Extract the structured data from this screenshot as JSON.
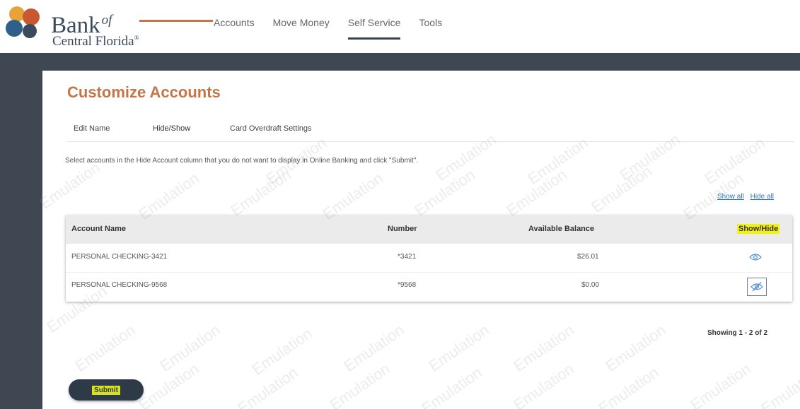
{
  "brand": {
    "name_line1": "Bank",
    "name_of": "of",
    "name_line2": "Central Florida",
    "trademark": "®"
  },
  "nav": {
    "items": [
      {
        "label": "Accounts"
      },
      {
        "label": "Move Money"
      },
      {
        "label": "Self Service",
        "active": true
      },
      {
        "label": "Tools"
      }
    ]
  },
  "page": {
    "title": "Customize Accounts",
    "tabs": [
      {
        "label": "Edit Name"
      },
      {
        "label": "Hide/Show",
        "active": true
      },
      {
        "label": "Card Overdraft Settings"
      }
    ],
    "instruction": "Select accounts in the Hide Account column that you do not want to display in Online Banking and click \"Submit\".",
    "show_all": "Show all",
    "hide_all": "Hide all"
  },
  "table": {
    "columns": [
      "Account Name",
      "Number",
      "Available Balance",
      "Show/Hide"
    ],
    "rows": [
      {
        "name": "PERSONAL CHECKING-3421",
        "number": "*3421",
        "balance": "$26.01",
        "visibility_icon": "eye-icon"
      },
      {
        "name": "PERSONAL CHECKING-9568",
        "number": "*9568",
        "balance": "$0.00",
        "visibility_icon": "eye-slash-icon"
      }
    ],
    "showing": "Showing 1 - 2 of 2"
  },
  "submit_label": "Submit",
  "watermark_text": "Emulation",
  "colors": {
    "accent_orange": "#c4764a",
    "dark_band": "#3f4752",
    "link_blue": "#2a74c8",
    "highlight_yellow": "#f2f20a"
  }
}
